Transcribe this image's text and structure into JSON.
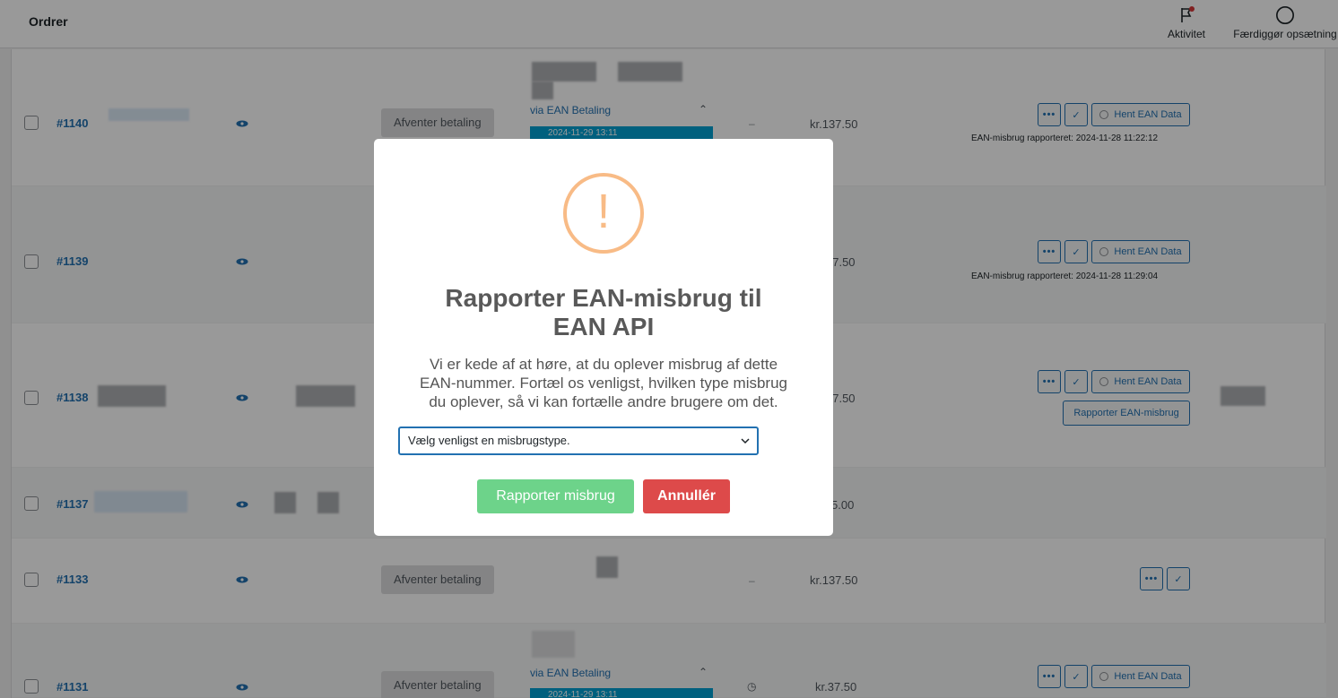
{
  "header": {
    "title": "Ordrer",
    "activity_label": "Aktivitet",
    "finish_setup_label": "Færdiggør opsætning"
  },
  "orders": [
    {
      "number": "#1140",
      "status": "Afventer betaling",
      "payment_via": "via EAN Betaling",
      "payment_date": "2024-11-29 13:11",
      "dash": "–",
      "total": "kr.137.50",
      "misuse_note": "EAN-misbrug rapporteret: 2024-11-28 11:22:12"
    },
    {
      "number": "#1139",
      "total": "37.50",
      "misuse_note": "EAN-misbrug rapporteret: 2024-11-28 11:29:04"
    },
    {
      "number": "#1138",
      "total": "37.50"
    },
    {
      "number": "#1137",
      "total": "5.00"
    },
    {
      "number": "#1133",
      "status": "Afventer betaling",
      "dash": "–",
      "total": "kr.137.50"
    },
    {
      "number": "#1131",
      "status": "Afventer betaling",
      "payment_via": "via EAN Betaling",
      "payment_date": "2024-11-29 13:11",
      "total": "kr.37.50"
    }
  ],
  "row_actions": {
    "more": "•••",
    "check": "✓",
    "fetch_ean": "Hent EAN Data",
    "report_misuse": "Rapporter EAN-misbrug"
  },
  "modal": {
    "icon": "warning-exclamation-icon",
    "icon_glyph": "!",
    "title": "Rapporter EAN-misbrug til EAN API",
    "text": "Vi er kede af at høre, at du oplever misbrug af dette EAN-nummer. Fortæl os venligst, hvilken type misbrug du oplever, så vi kan fortælle andre brugere om det.",
    "select_placeholder": "Vælg venligst en misbrugstype.",
    "confirm_label": "Rapporter misbrug",
    "cancel_label": "Annullér"
  },
  "colors": {
    "accent": "#2271b1",
    "warning": "#f8bb86",
    "confirm": "#6dd38a",
    "cancel": "#dd4a4a",
    "teal": "#00a0d2"
  }
}
